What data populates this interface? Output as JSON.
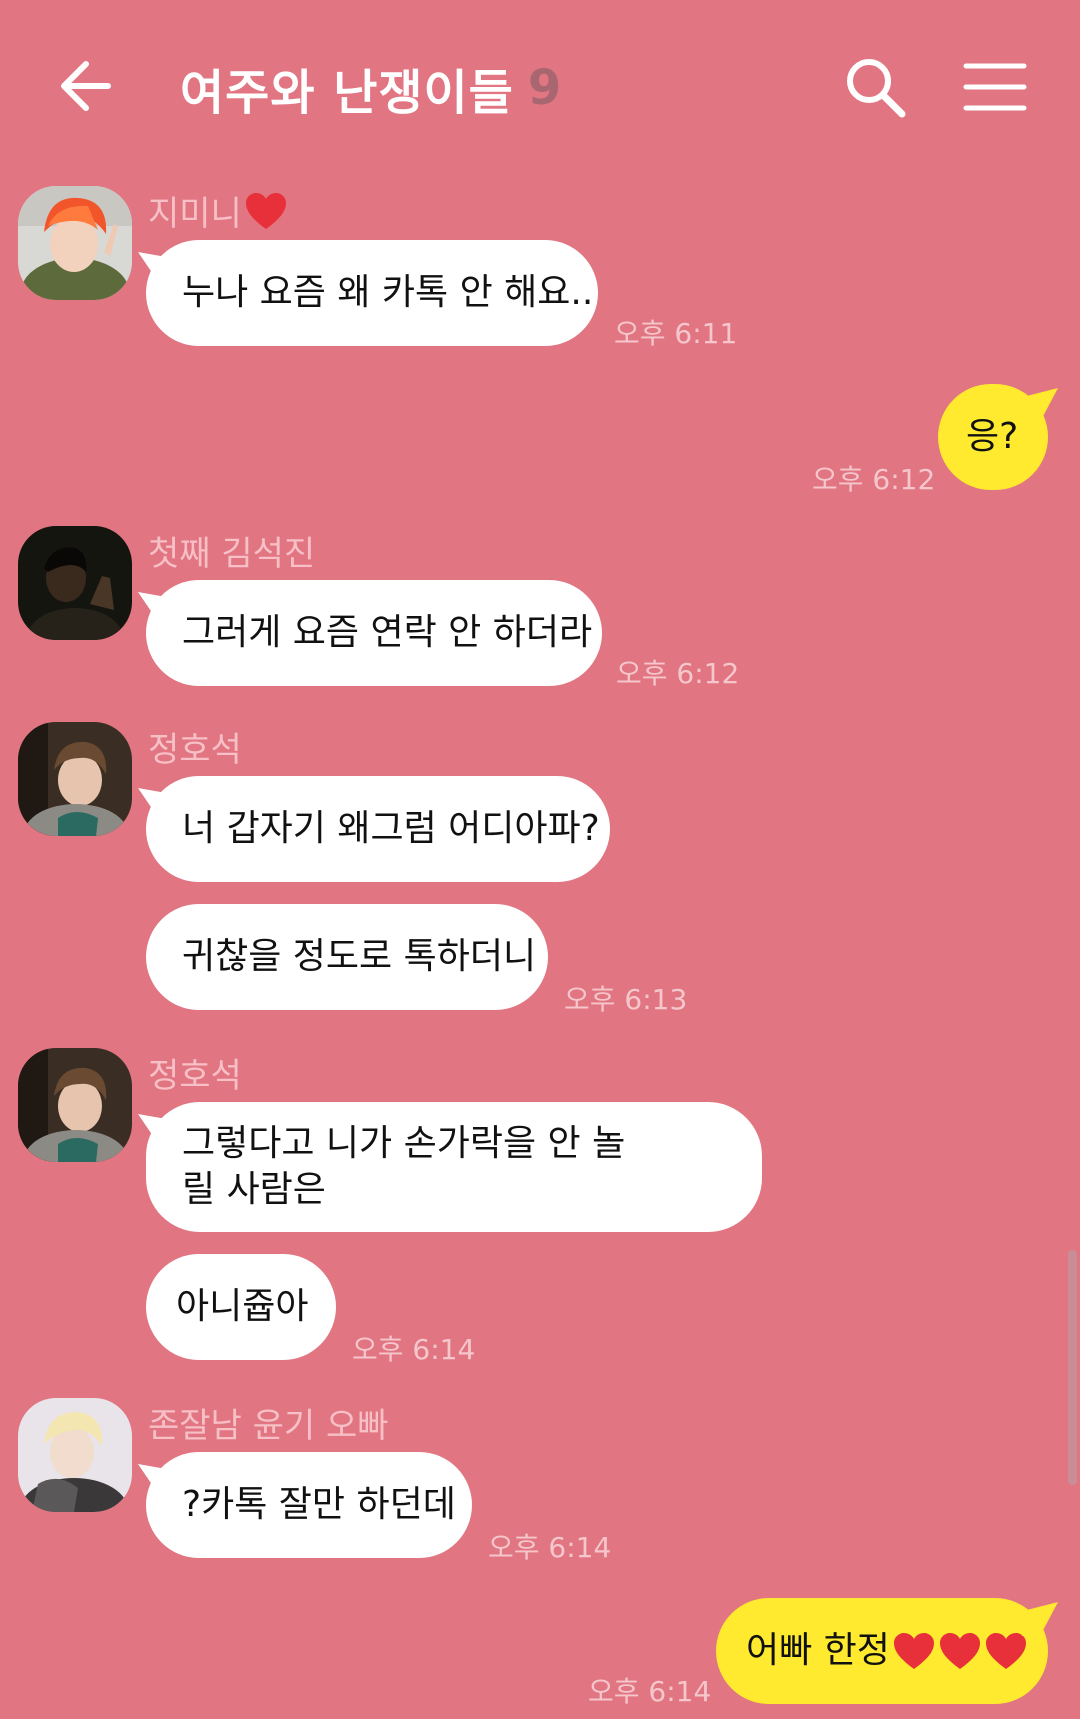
{
  "header": {
    "title": "여주와 난쟁이들",
    "member_count": "9",
    "back_icon": "arrow-left-icon",
    "search_icon": "search-icon",
    "menu_icon": "hamburger-menu-icon"
  },
  "messages": [
    {
      "sender": "지미니",
      "text": "누나 요즘 왜 카톡 안 해요..",
      "time": "오후 6:11"
    },
    {
      "text": "응?",
      "time": "오후 6:12"
    },
    {
      "sender": "첫째 김석진",
      "text": "그러게 요즘 연락 안 하더라",
      "time": "오후 6:12"
    },
    {
      "sender": "정호석",
      "text": "너 갑자기 왜그럼 어디아파?"
    },
    {
      "text": "귀찮을 정도로 톡하더니",
      "time": "오후 6:13"
    },
    {
      "sender": "정호석",
      "text": "그렇다고 니가 손가락을 안 놀릴 사람은"
    },
    {
      "text": "아니쥽아",
      "time": "오후 6:14"
    },
    {
      "sender": "존잘남 윤기 오빠",
      "text": "?카톡 잘만 하던데",
      "time": "오후 6:14"
    },
    {
      "text": "어빠 한정",
      "time": "오후 6:14"
    }
  ],
  "colors": {
    "background": "#E17581",
    "incoming_bubble": "#FFFFFF",
    "outgoing_bubble": "#FFEA2F",
    "sender_name": "#F7BFC6",
    "timestamp": "#F5C6CC",
    "heart": "#E8303A"
  }
}
